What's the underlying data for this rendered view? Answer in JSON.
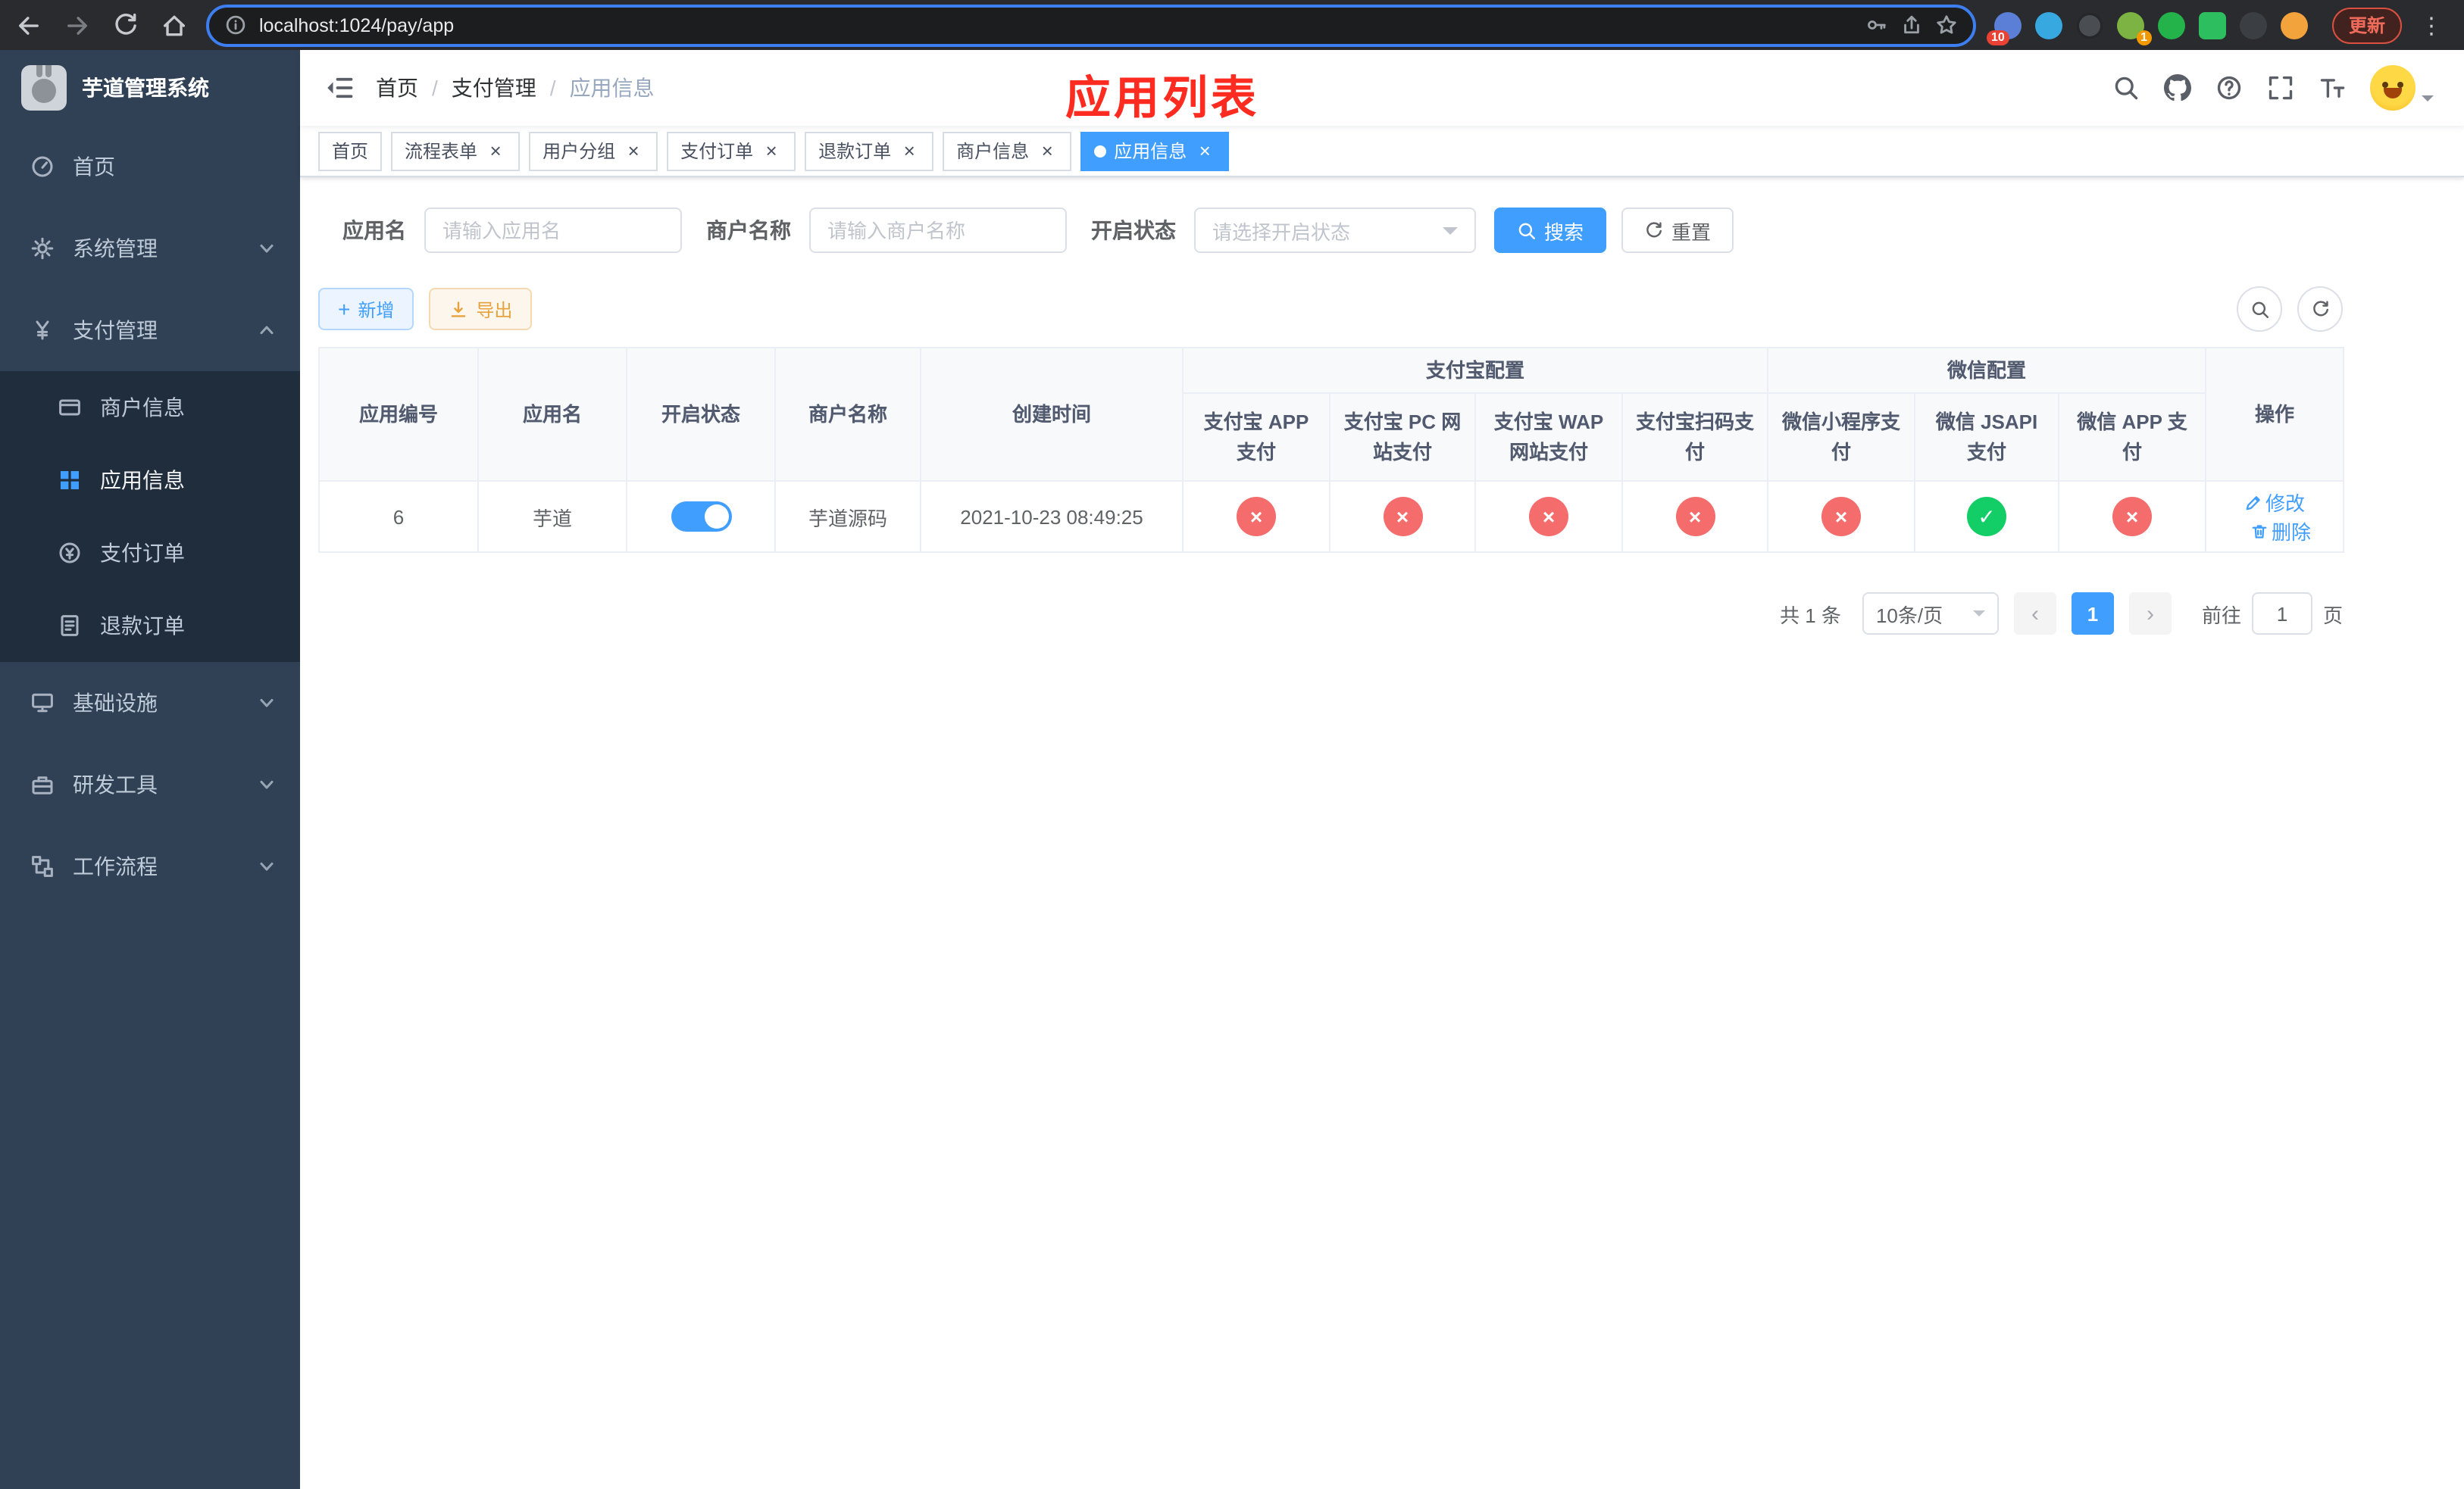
{
  "browser": {
    "url": "localhost:1024/pay/app",
    "update_label": "更新",
    "ext_badge_puzzle": "10",
    "ext_badge_green": "1"
  },
  "icons": {
    "close": "×",
    "plus": "+",
    "kebab": "⋮",
    "prev": "‹",
    "next": "›",
    "check": "✓",
    "cross": "×",
    "breadcrumb_sep": "/"
  },
  "sidebar": {
    "title": "芋道管理系统",
    "menu": [
      {
        "label": "首页"
      },
      {
        "label": "系统管理"
      },
      {
        "label": "支付管理"
      },
      {
        "label": "商户信息"
      },
      {
        "label": "应用信息"
      },
      {
        "label": "支付订单"
      },
      {
        "label": "退款订单"
      },
      {
        "label": "基础设施"
      },
      {
        "label": "研发工具"
      },
      {
        "label": "工作流程"
      }
    ]
  },
  "navbar": {
    "breadcrumb": {
      "home": "首页",
      "section": "支付管理",
      "current": "应用信息"
    },
    "annotation": "应用列表"
  },
  "tabs": [
    {
      "label": "首页"
    },
    {
      "label": "流程表单"
    },
    {
      "label": "用户分组"
    },
    {
      "label": "支付订单"
    },
    {
      "label": "退款订单"
    },
    {
      "label": "商户信息"
    },
    {
      "label": "应用信息"
    }
  ],
  "filters": {
    "app_name_label": "应用名",
    "app_name_placeholder": "请输入应用名",
    "merchant_label": "商户名称",
    "merchant_placeholder": "请输入商户名称",
    "status_label": "开启状态",
    "status_placeholder": "请选择开启状态",
    "search_label": "搜索",
    "reset_label": "重置"
  },
  "toolbar": {
    "add_label": "新增",
    "export_label": "导出"
  },
  "table": {
    "headers": {
      "app_id": "应用编号",
      "app_name": "应用名",
      "status": "开启状态",
      "merchant": "商户名称",
      "created": "创建时间",
      "alipay_group": "支付宝配置",
      "wechat_group": "微信配置",
      "actions": "操作",
      "pay_columns": [
        "支付宝 APP 支付",
        "支付宝 PC 网站支付",
        "支付宝 WAP 网站支付",
        "支付宝扫码支付",
        "微信小程序支付",
        "微信 JSAPI 支付",
        "微信 APP 支付"
      ]
    },
    "rows": [
      {
        "app_id": "6",
        "app_name": "芋道",
        "status_on": true,
        "merchant": "芋道源码",
        "created": "2021-10-23 08:49:25",
        "pay_statuses": [
          false,
          false,
          false,
          false,
          false,
          true,
          false
        ],
        "edit_label": "修改",
        "delete_label": "删除"
      }
    ]
  },
  "pagination": {
    "total_label": "共 1 条",
    "page_size_label": "10条/页",
    "current_page": "1",
    "goto_label": "前往",
    "goto_value": "1",
    "page_unit_label": "页"
  },
  "colors": {
    "primary": "#409eff",
    "success": "#13ce66",
    "danger": "#f56c6c",
    "warning": "#e6a23c",
    "annotation": "#fe2b20",
    "sidebar_bg": "#304156",
    "submenu_bg": "#1f2d3d"
  }
}
